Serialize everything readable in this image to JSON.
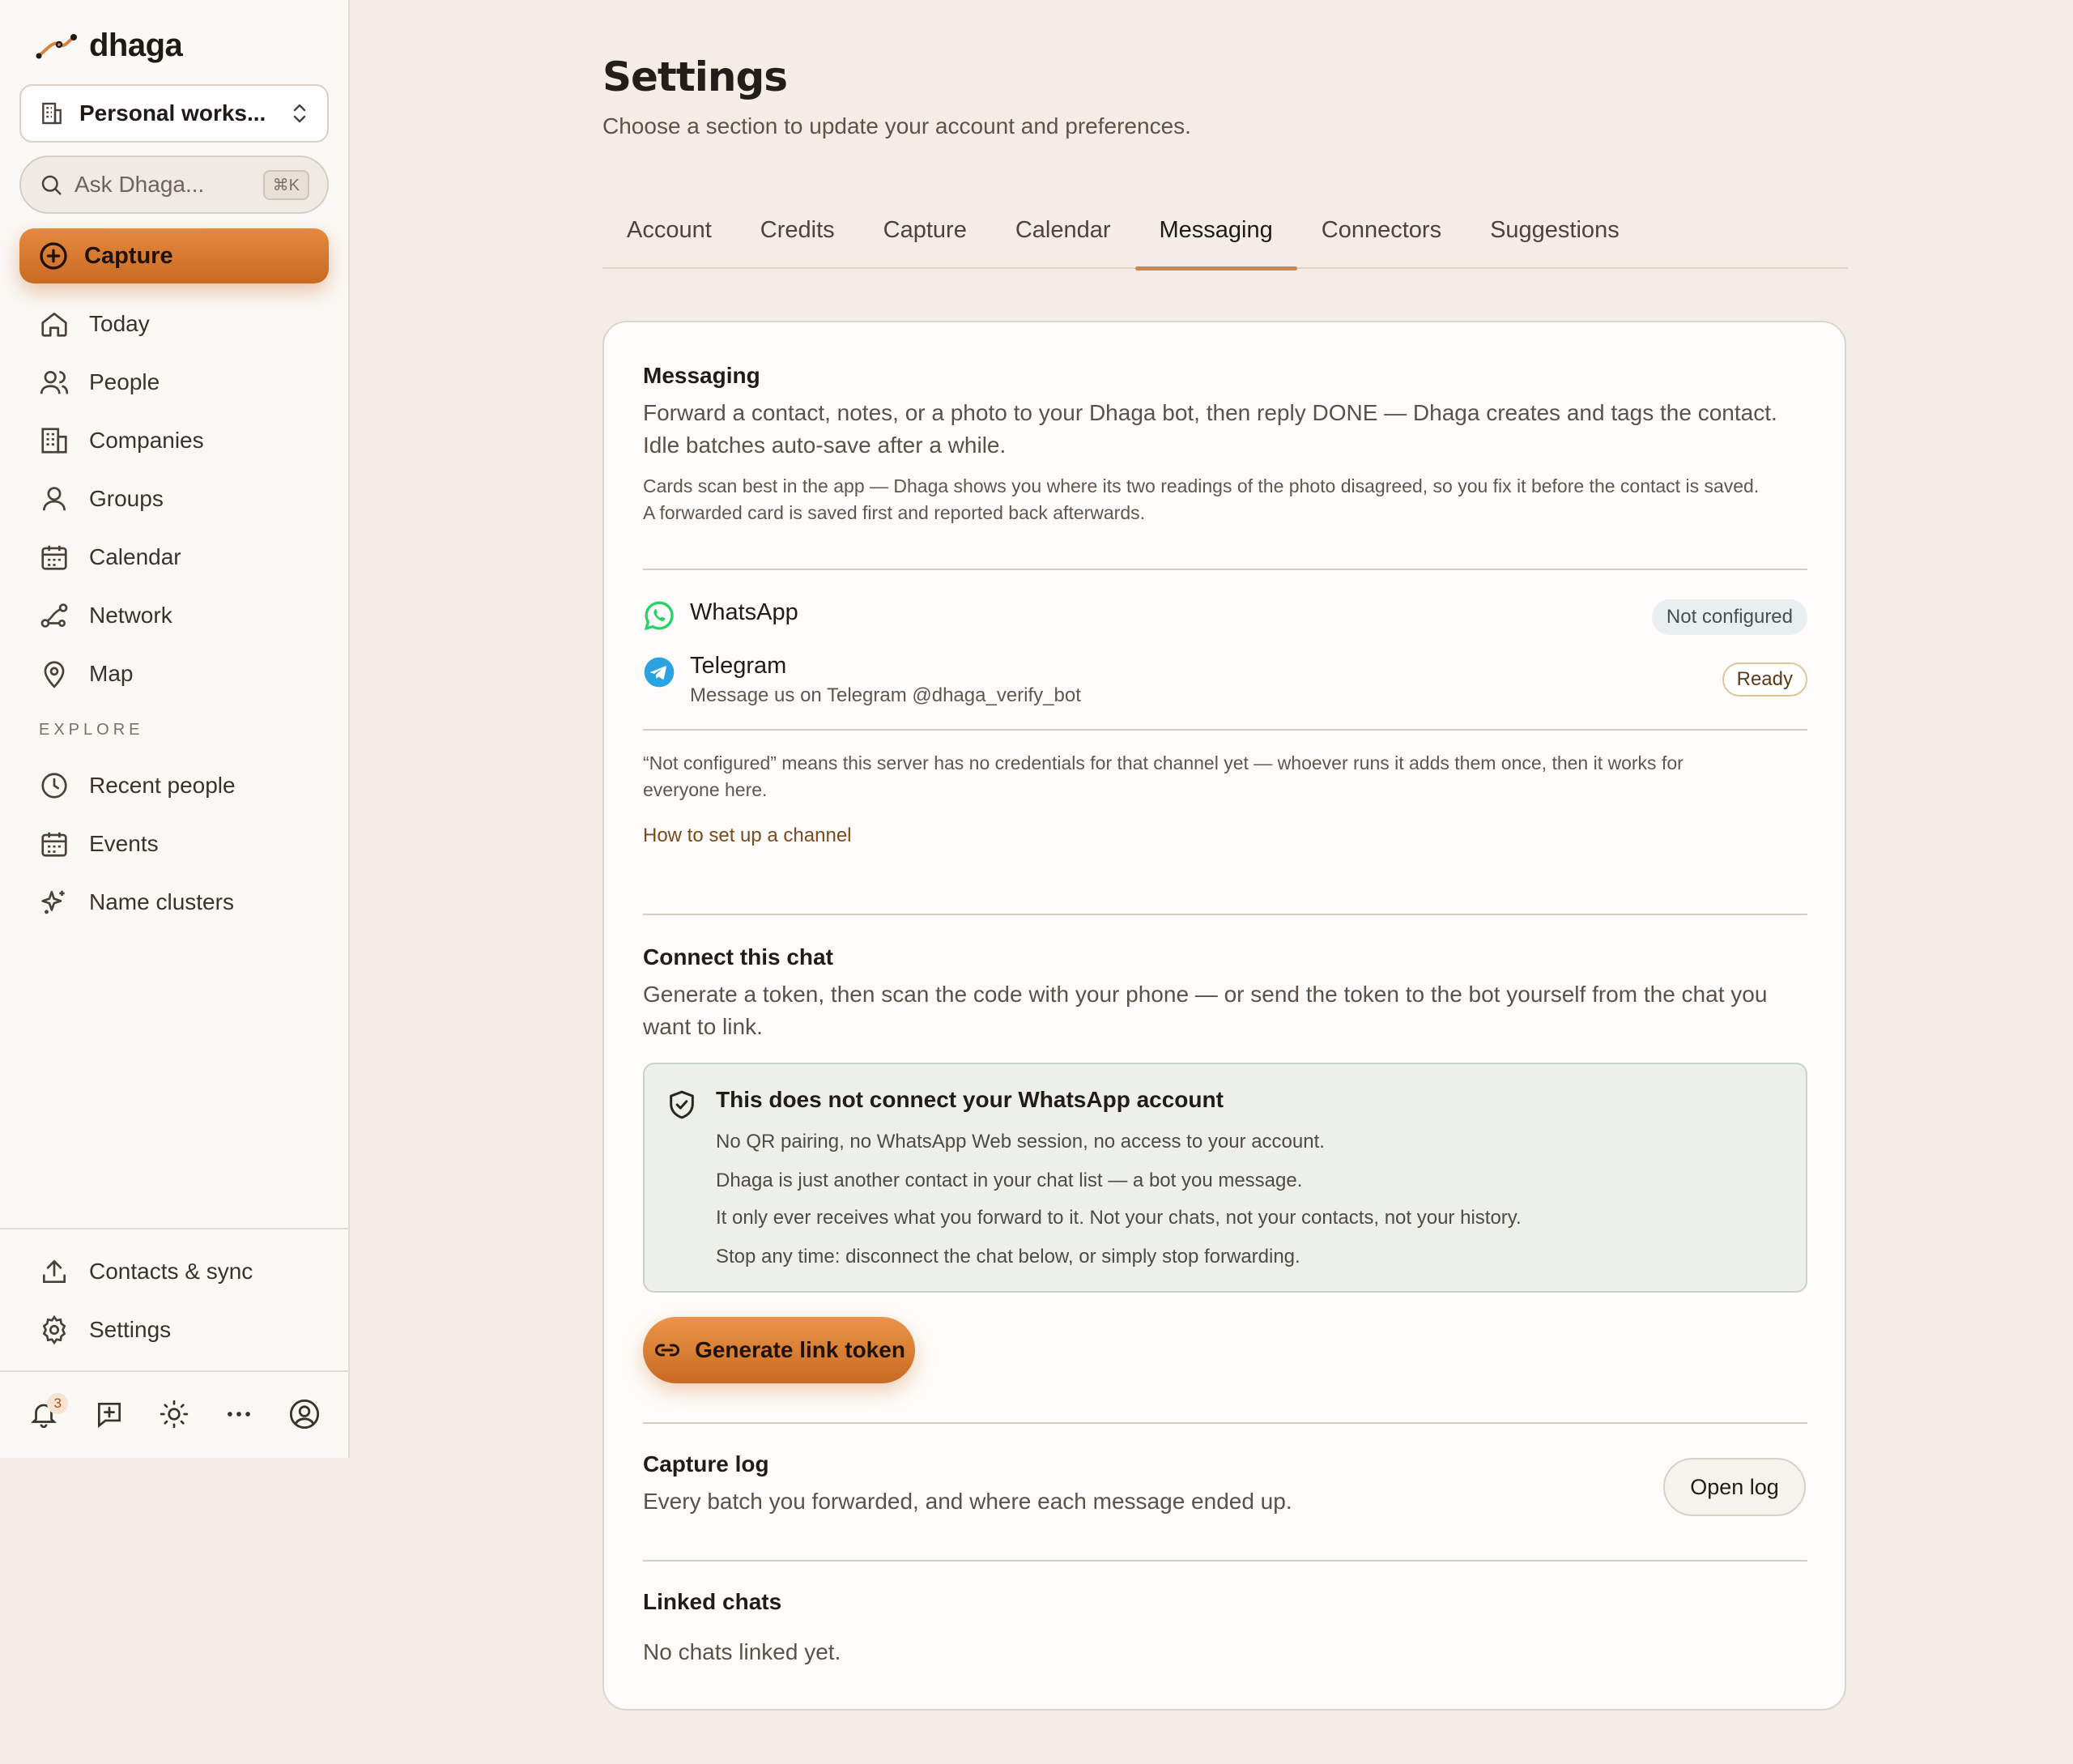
{
  "app": {
    "name": "dhaga"
  },
  "sidebar": {
    "workspace": "Personal works...",
    "search_placeholder": "Ask Dhaga...",
    "search_shortcut": "⌘K",
    "capture_label": "Capture",
    "nav": [
      {
        "label": "Today",
        "icon": "home-icon"
      },
      {
        "label": "People",
        "icon": "people-icon"
      },
      {
        "label": "Companies",
        "icon": "building-icon"
      },
      {
        "label": "Groups",
        "icon": "user-icon"
      },
      {
        "label": "Calendar",
        "icon": "calendar-icon"
      },
      {
        "label": "Network",
        "icon": "network-icon"
      },
      {
        "label": "Map",
        "icon": "map-pin-icon"
      }
    ],
    "explore_heading": "EXPLORE",
    "explore": [
      {
        "label": "Recent people",
        "icon": "clock-icon"
      },
      {
        "label": "Events",
        "icon": "calendar-icon"
      },
      {
        "label": "Name clusters",
        "icon": "sparkles-icon"
      }
    ],
    "footer_nav": [
      {
        "label": "Contacts & sync",
        "icon": "upload-icon"
      },
      {
        "label": "Settings",
        "icon": "gear-icon"
      }
    ],
    "notification_count": "3"
  },
  "settings": {
    "title": "Settings",
    "subtitle": "Choose a section to update your account and preferences.",
    "tabs": [
      "Account",
      "Credits",
      "Capture",
      "Calendar",
      "Messaging",
      "Connectors",
      "Suggestions"
    ],
    "active_tab": "Messaging"
  },
  "messaging": {
    "heading": "Messaging",
    "desc_line1": "Forward a contact, notes, or a photo to your Dhaga bot, then reply DONE — Dhaga creates and tags the contact.",
    "desc_line2": "Idle batches auto-save after a while.",
    "note_line1": "Cards scan best in the app — Dhaga shows you where its two readings of the photo disagreed, so you fix it before the contact is saved.",
    "note_line2": "A forwarded card is saved first and reported back afterwards.",
    "channels": [
      {
        "name": "WhatsApp",
        "status": "Not configured",
        "sub": ""
      },
      {
        "name": "Telegram",
        "status": "Ready",
        "sub": "Message us on Telegram @dhaga_verify_bot"
      }
    ],
    "not_configured_note_line1": "“Not configured” means this server has no credentials for that channel yet — whoever runs it adds them once, then it works for",
    "not_configured_note_line2": "everyone here.",
    "setup_link": "How to set up a channel"
  },
  "connect": {
    "heading": "Connect this chat",
    "desc_line1": "Generate a token, then scan the code with your phone — or send the token to the bot yourself from the chat you",
    "desc_line2": "want to link.",
    "notice_title": "This does not connect your WhatsApp account",
    "notice_lines": [
      "No QR pairing, no WhatsApp Web session, no access to your account.",
      "Dhaga is just another contact in your chat list — a bot you message.",
      "It only ever receives what you forward to it. Not your chats, not your contacts, not your history.",
      "Stop any time: disconnect the chat below, or simply stop forwarding."
    ],
    "generate_button": "Generate link token"
  },
  "capture_log": {
    "heading": "Capture log",
    "desc": "Every batch you forwarded, and where each message ended up.",
    "button": "Open log"
  },
  "linked_chats": {
    "heading": "Linked chats",
    "empty": "No chats linked yet."
  },
  "colors": {
    "accent": "#d9823b",
    "background": "#f3ede6",
    "sidebar": "#faf8f5",
    "whatsapp": "#25d366",
    "telegram": "#2aa3e0"
  }
}
